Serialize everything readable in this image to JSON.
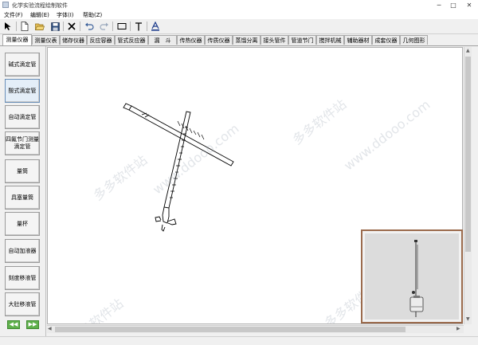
{
  "window": {
    "title": "化学实验流程绘制软件",
    "minimize_glyph": "─",
    "maximize_glyph": "□",
    "close_glyph": "✕"
  },
  "menu": [
    "文件(F)",
    "编辑(E)",
    "字体(I)",
    "帮助(Z)"
  ],
  "toolbar": {
    "icons": [
      "pointer-icon",
      "new-file-icon",
      "open-folder-icon",
      "save-icon",
      "delete-icon",
      "undo-icon",
      "redo-icon",
      "rectangle-icon",
      "text-icon",
      "font-color-icon"
    ]
  },
  "tabs": {
    "items": [
      "测量仪器",
      "测量仪表",
      "储存仪器",
      "反应容器",
      "管式反应器",
      "漏　斗",
      "传热仪器",
      "传质仪器",
      "蒸馏分离",
      "接头管件",
      "管道节门",
      "搅拌机械",
      "辅助器材",
      "成套仪器",
      "几何图形"
    ],
    "active_index": 0
  },
  "left_panel": {
    "buttons": [
      "碱式滴定管",
      "酸式滴定管",
      "自动滴定管",
      "四氟节门测量滴定管",
      "量筒",
      "具塞量筒",
      "量杯",
      "自动加液器",
      "刻度移液管",
      "大肚移液管"
    ],
    "selected_index": 1,
    "prev_glyph": "◀◀",
    "next_glyph": "▶▶"
  },
  "watermarks": [
    "多多软件站",
    "www.ddooo.com"
  ],
  "colors": {
    "preview_border": "#9b6b4d",
    "nav_button_green": "#5fb04b",
    "selected_button": "#e4eef8"
  }
}
